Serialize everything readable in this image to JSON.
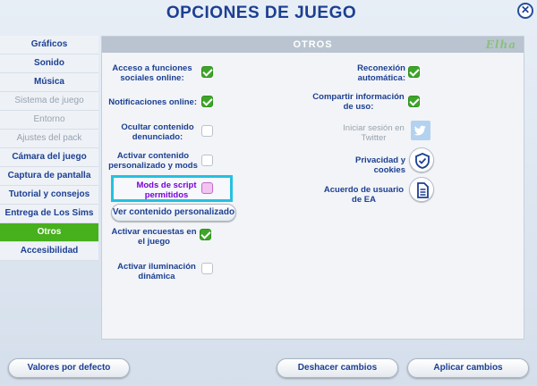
{
  "window": {
    "title": "Opciones de juego",
    "close_label": "✕"
  },
  "sidebar": {
    "items": [
      {
        "label": "Gráficos",
        "state": "normal"
      },
      {
        "label": "Sonido",
        "state": "normal"
      },
      {
        "label": "Música",
        "state": "normal"
      },
      {
        "label": "Sistema de juego",
        "state": "disabled"
      },
      {
        "label": "Entorno",
        "state": "disabled"
      },
      {
        "label": "Ajustes del pack",
        "state": "disabled"
      },
      {
        "label": "Cámara del juego",
        "state": "normal"
      },
      {
        "label": "Captura de pantalla",
        "state": "normal"
      },
      {
        "label": "Tutorial y consejos",
        "state": "normal"
      },
      {
        "label": "Entrega de Los Sims",
        "state": "normal"
      },
      {
        "label": "Otros",
        "state": "active"
      },
      {
        "label": "Accesibilidad",
        "state": "normal"
      }
    ]
  },
  "panel": {
    "title": "Otros",
    "logo_text": "Elha",
    "left_options": {
      "social": {
        "label": "Acceso a funciones sociales online:",
        "checked": true
      },
      "notifications": {
        "label": "Notificaciones online:",
        "checked": true
      },
      "hide_reported": {
        "label": "Ocultar contenido denunciado:",
        "checked": false
      },
      "custom_content": {
        "label": "Activar contenido personalizado y mods",
        "checked": false
      },
      "script_mods": {
        "label": "Mods de script permitidos",
        "checked": false
      },
      "view_cc_button": "Ver contenido personalizado",
      "surveys": {
        "label": "Activar encuestas en el juego",
        "checked": true
      },
      "dynamic_lighting": {
        "label": "Activar iluminación dinámica",
        "checked": false
      }
    },
    "right_options": {
      "auto_reconnect": {
        "label": "Reconexión automática:",
        "checked": true
      },
      "share_usage": {
        "label": "Compartir información de uso:",
        "checked": true
      },
      "twitter": {
        "label": "Iniciar sesión en Twitter",
        "icon": "twitter-icon"
      },
      "privacy": {
        "label": "Privacidad y cookies",
        "icon": "shield-check-icon"
      },
      "user_agreement": {
        "label": "Acuerdo de usuario de EA",
        "icon": "document-icon"
      }
    }
  },
  "footer": {
    "defaults": "Valores por defecto",
    "undo": "Deshacer cambios",
    "apply": "Aplicar cambios"
  },
  "colors": {
    "accent_green": "#47b01d",
    "checkbox_green": "#3fa52a",
    "highlight_cyan": "#23c1e0",
    "text_blue": "#1c3f92",
    "script_mods_purple": "#7a00d9"
  }
}
